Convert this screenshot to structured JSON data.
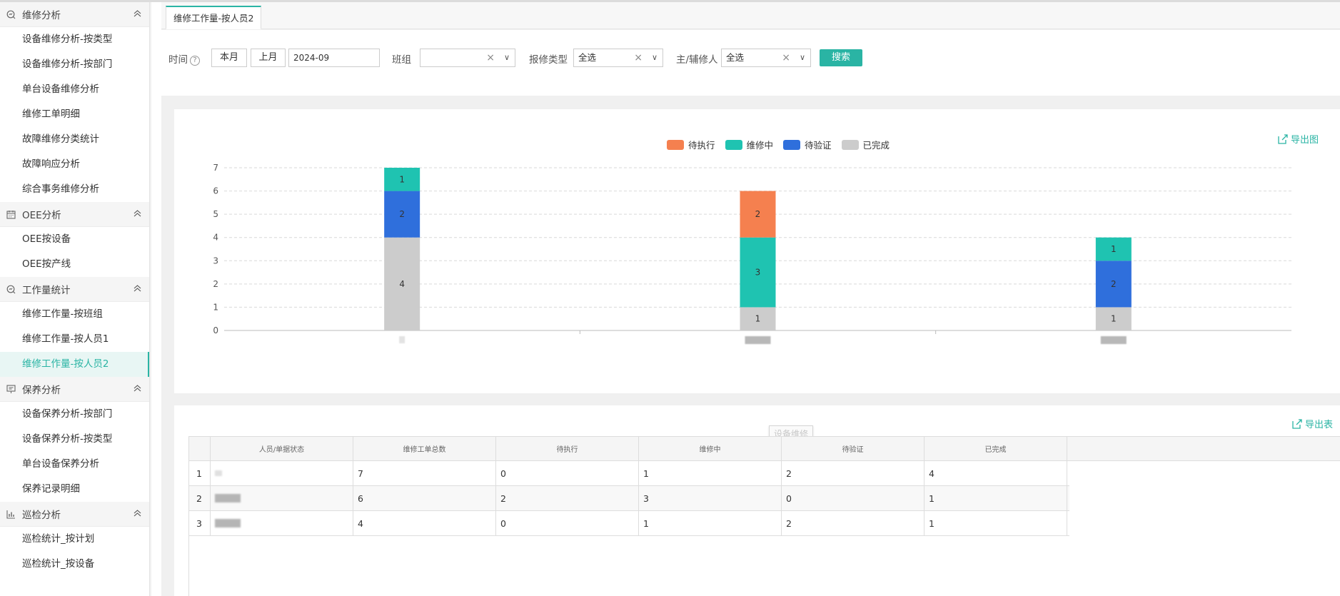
{
  "sidebar": {
    "groups": [
      {
        "title": "维修分析",
        "icon": "magnifier-chart-icon",
        "items": [
          "设备维修分析-按类型",
          "设备维修分析-按部门",
          "单台设备维修分析",
          "维修工单明细",
          "故障维修分类统计",
          "故障响应分析",
          "综合事务维修分析"
        ]
      },
      {
        "title": "OEE分析",
        "icon": "calendar-icon",
        "items": [
          "OEE按设备",
          "OEE按产线"
        ]
      },
      {
        "title": "工作量统计",
        "icon": "magnifier-chart-icon",
        "items": [
          "维修工作量-按班组",
          "维修工作量-按人员1",
          "维修工作量-按人员2"
        ]
      },
      {
        "title": "保养分析",
        "icon": "presentation-icon",
        "items": [
          "设备保养分析-按部门",
          "设备保养分析-按类型",
          "单台设备保养分析",
          "保养记录明细"
        ]
      },
      {
        "title": "巡检分析",
        "icon": "bar-chart-icon",
        "items": [
          "巡检统计_按计划",
          "巡检统计_按设备"
        ]
      }
    ],
    "active_item": "维修工作量-按人员2"
  },
  "tabs": [
    {
      "label": "维修工作量-按人员2"
    }
  ],
  "filters": {
    "time_label": "时间",
    "this_month": "本月",
    "last_month": "上月",
    "date_value": "2024-09",
    "team_label": "班组",
    "team_value": "",
    "repair_type_label": "报修类型",
    "repair_type_value": "全选",
    "person_label": "主/辅修人",
    "person_value": "全选",
    "search_label": "搜索"
  },
  "chart_export": "导出图",
  "table_export": "导出表",
  "tooltip_text": "设备维修",
  "colors": {
    "pending": "#f5804f",
    "repairing": "#1fc3b1",
    "verifying": "#2f6fdc",
    "done": "#cccccc",
    "accent": "#2ab4a4"
  },
  "chart_data": {
    "type": "bar",
    "stacked": true,
    "categories": [
      "",
      "",
      ""
    ],
    "series": [
      {
        "name": "已完成",
        "values": [
          4,
          1,
          1
        ]
      },
      {
        "name": "待验证",
        "values": [
          2,
          0,
          2
        ]
      },
      {
        "name": "维修中",
        "values": [
          1,
          3,
          1
        ]
      },
      {
        "name": "待执行",
        "values": [
          0,
          2,
          0
        ]
      }
    ],
    "legend_order": [
      "待执行",
      "维修中",
      "待验证",
      "已完成"
    ],
    "legend_position": "top-center",
    "ylim": [
      0,
      7
    ],
    "yticks": [
      0,
      1,
      2,
      3,
      4,
      5,
      6,
      7
    ],
    "grid": true
  },
  "table": {
    "columns": [
      "",
      "人员/单据状态",
      "维修工单总数",
      "待执行",
      "维修中",
      "待验证",
      "已完成"
    ],
    "rows": [
      {
        "idx": "1",
        "total": "7",
        "pending": "0",
        "repairing": "1",
        "verifying": "2",
        "done": "4"
      },
      {
        "idx": "2",
        "total": "6",
        "pending": "2",
        "repairing": "3",
        "verifying": "0",
        "done": "1"
      },
      {
        "idx": "3",
        "total": "4",
        "pending": "0",
        "repairing": "1",
        "verifying": "2",
        "done": "1"
      }
    ]
  }
}
